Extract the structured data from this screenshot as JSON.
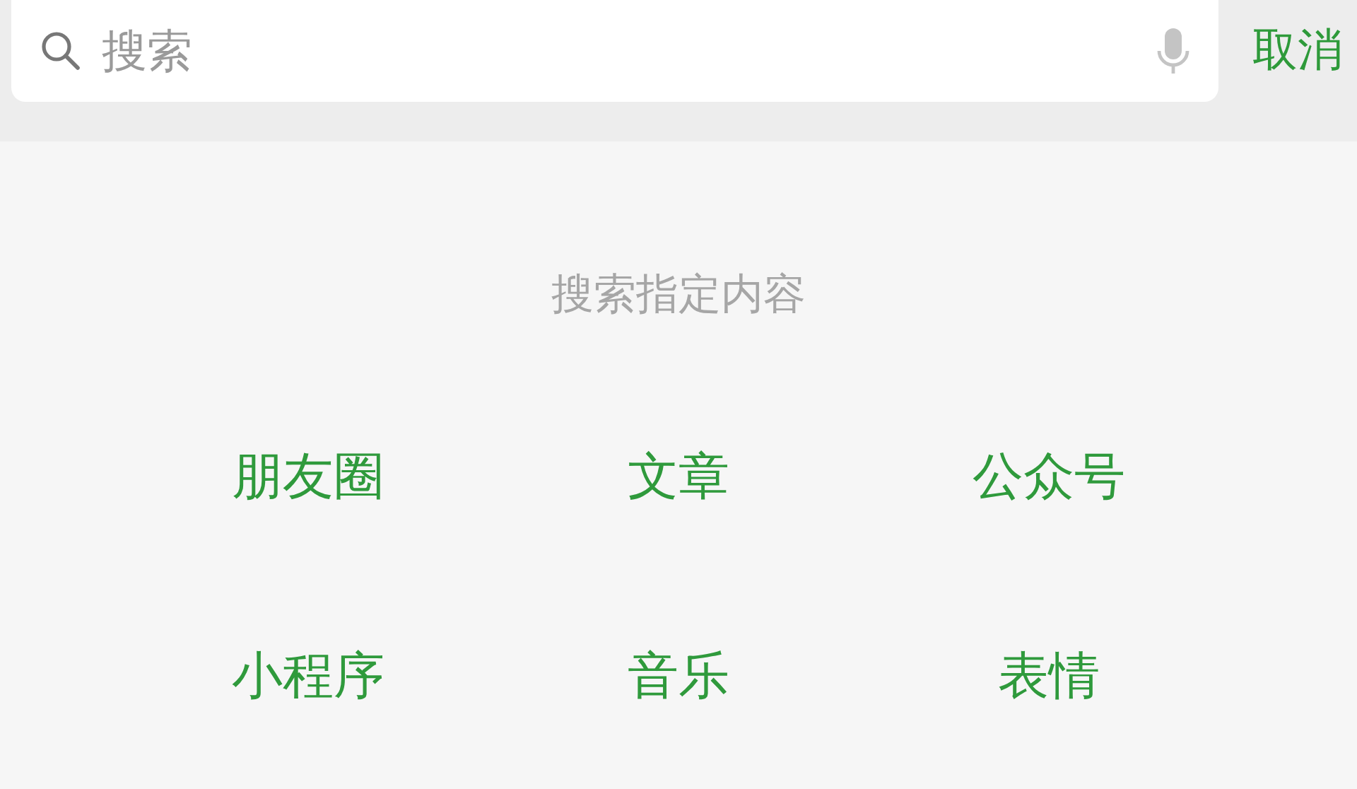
{
  "search": {
    "placeholder": "搜索"
  },
  "cancel": "取消",
  "hint": "搜索指定内容",
  "categories": [
    {
      "label": "朋友圈"
    },
    {
      "label": "文章"
    },
    {
      "label": "公众号"
    },
    {
      "label": "小程序"
    },
    {
      "label": "音乐"
    },
    {
      "label": "表情"
    }
  ]
}
